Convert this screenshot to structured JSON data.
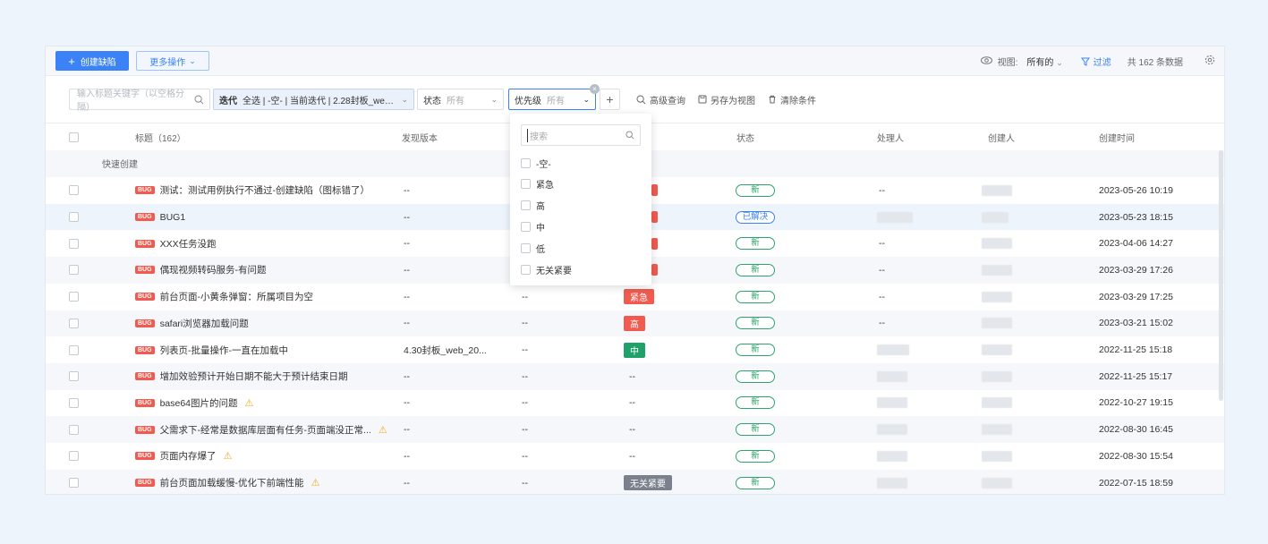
{
  "toolbar": {
    "create_label": "创建缺陷",
    "more_label": "更多操作",
    "view_label": "视图:",
    "view_value": "所有的",
    "filter_label": "过滤",
    "count_label": "共 162 条数据"
  },
  "filters": {
    "search_placeholder": "输入标题关键字（以空格分隔）",
    "iteration_key": "迭代",
    "iteration_value": "全选 | -空- | 当前迭代 | 2.28封板_web_20...",
    "status_key": "状态",
    "status_value": "所有",
    "priority_key": "优先级",
    "priority_value": "所有",
    "add_label": "+",
    "advanced_query": "高级查询",
    "save_view": "另存为视图",
    "clear_conditions": "清除条件"
  },
  "table": {
    "columns": {
      "title": "标题（162）",
      "found_version": "发现版本",
      "status": "状态",
      "handler": "处理人",
      "creator": "创建人",
      "created_time": "创建时间"
    },
    "quick_create": "快速创建",
    "bug_tag": "BUG",
    "rows": [
      {
        "title": "测试：测试用例执行不通过-创建缺陷（图标错了）",
        "version": "--",
        "module": "",
        "priority": "",
        "status": "新",
        "handler": "--",
        "created": "2023-05-26 10:19"
      },
      {
        "title": "BUG1",
        "version": "--",
        "module": "",
        "priority": "",
        "status": "已解决",
        "handler": "",
        "created": "2023-05-23 18:15"
      },
      {
        "title": "XXX任务没跑",
        "version": "--",
        "module": "",
        "priority": "",
        "status": "新",
        "handler": "--",
        "created": "2023-04-06 14:27"
      },
      {
        "title": "偶现视频转码服务-有问题",
        "version": "--",
        "module": "",
        "priority": "",
        "status": "新",
        "handler": "--",
        "created": "2023-03-29 17:26"
      },
      {
        "title": "前台页面-小黄条弹窗：所属项目为空",
        "version": "--",
        "module": "--",
        "priority": "紧急",
        "status": "新",
        "handler": "--",
        "created": "2023-03-29 17:25"
      },
      {
        "title": "safari浏览器加载问题",
        "version": "--",
        "module": "--",
        "priority": "高",
        "status": "新",
        "handler": "--",
        "created": "2023-03-21 15:02"
      },
      {
        "title": "列表页-批量操作-一直在加载中",
        "version": "4.30封板_web_20...",
        "module": "--",
        "priority": "中",
        "status": "新",
        "handler": "",
        "created": "2022-11-25 15:18"
      },
      {
        "title": "增加效验预计开始日期不能大于预计结束日期",
        "version": "--",
        "module": "--",
        "priority": "--",
        "status": "新",
        "handler": "",
        "created": "2022-11-25 15:17"
      },
      {
        "title": "base64图片的问题",
        "version": "--",
        "module": "--",
        "priority": "--",
        "status": "新",
        "handler": "",
        "created": "2022-10-27 19:15",
        "warn": true
      },
      {
        "title": "父需求下-经常是数据库层面有任务-页面端没正常...",
        "version": "--",
        "module": "--",
        "priority": "--",
        "status": "新",
        "handler": "",
        "created": "2022-08-30 16:45",
        "warn": true
      },
      {
        "title": "页面内存爆了",
        "version": "--",
        "module": "--",
        "priority": "--",
        "status": "新",
        "handler": "",
        "created": "2022-08-30 15:54",
        "warn": true
      },
      {
        "title": "前台页面加载缓慢-优化下前端性能",
        "version": "--",
        "module": "--",
        "priority": "无关紧要",
        "status": "新",
        "handler": "",
        "created": "2022-07-15 18:59",
        "warn": true
      }
    ]
  },
  "priority_dropdown": {
    "search_placeholder": "搜索",
    "options": [
      "-空-",
      "紧急",
      "高",
      "中",
      "低",
      "无关紧要"
    ]
  },
  "colors": {
    "primary": "#3b82f6",
    "urgent": "#f05a4f",
    "high": "#f05a4f",
    "medium": "#21a16a",
    "trivial": "#7a818c",
    "status_new": "#2fa36b",
    "status_resolved": "#3b82f6"
  }
}
